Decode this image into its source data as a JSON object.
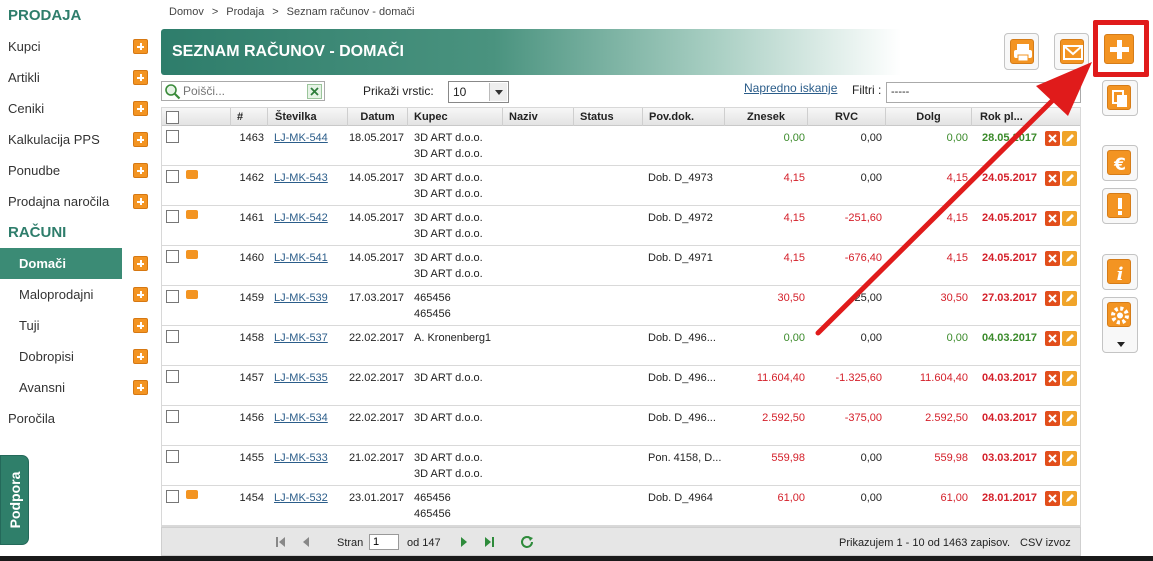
{
  "sidebar": {
    "section_prodaja": "PRODAJA",
    "items_prodaja": [
      "Kupci",
      "Artikli",
      "Ceniki",
      "Kalkulacija PPS",
      "Ponudbe",
      "Prodajna naročila"
    ],
    "section_racuni": "RAČUNI",
    "items_racuni": [
      "Domači",
      "Maloprodajni",
      "Tuji",
      "Dobropisi",
      "Avansni"
    ],
    "porocila": "Poročila"
  },
  "support_tab": "Podpora",
  "breadcrumb": [
    "Domov",
    "Prodaja",
    "Seznam računov - domači"
  ],
  "breadcrumb_sep": ">",
  "page_title": "SEZNAM RAČUNOV - DOMAČI",
  "toolbar": {
    "search_placeholder": "Poišči...",
    "rows_label": "Prikaži vrstic:",
    "rows_value": "10",
    "advanced_search": "Napredno iskanje",
    "filters_label": "Filtri :",
    "filters_value": "-----"
  },
  "table": {
    "headers": [
      "#",
      "Številka",
      "Datum",
      "Kupec",
      "Naziv",
      "Status",
      "Pov.dok.",
      "Znesek",
      "RVC",
      "Dolg",
      "Rok pl..."
    ],
    "rows": [
      {
        "id": "1463",
        "num": "LJ-MK-544",
        "date": "18.05.2017",
        "kupec": [
          "3D ART d.o.o.",
          "3D ART d.o.o."
        ],
        "pov": "",
        "znesek": "0,00",
        "rvc": "0,00",
        "dolg": "0,00",
        "rok": "28.05.2017",
        "printer": false,
        "kind": "pos"
      },
      {
        "id": "1462",
        "num": "LJ-MK-543",
        "date": "14.05.2017",
        "kupec": [
          "3D ART d.o.o.",
          "3D ART d.o.o."
        ],
        "pov": "Dob. D_4973",
        "znesek": "4,15",
        "rvc": "0,00",
        "dolg": "4,15",
        "rok": "24.05.2017",
        "printer": true,
        "kind": "neg"
      },
      {
        "id": "1461",
        "num": "LJ-MK-542",
        "date": "14.05.2017",
        "kupec": [
          "3D ART d.o.o.",
          "3D ART d.o.o."
        ],
        "pov": "Dob. D_4972",
        "znesek": "4,15",
        "rvc": "-251,60",
        "dolg": "4,15",
        "rok": "24.05.2017",
        "printer": true,
        "kind": "neg"
      },
      {
        "id": "1460",
        "num": "LJ-MK-541",
        "date": "14.05.2017",
        "kupec": [
          "3D ART d.o.o.",
          "3D ART d.o.o."
        ],
        "pov": "Dob. D_4971",
        "znesek": "4,15",
        "rvc": "-676,40",
        "dolg": "4,15",
        "rok": "24.05.2017",
        "printer": true,
        "kind": "neg"
      },
      {
        "id": "1459",
        "num": "LJ-MK-539",
        "date": "17.03.2017",
        "kupec": [
          "465456",
          "465456"
        ],
        "pov": "",
        "znesek": "30,50",
        "rvc": "25,00",
        "dolg": "30,50",
        "rok": "27.03.2017",
        "printer": true,
        "kind": "neg"
      },
      {
        "id": "1458",
        "num": "LJ-MK-537",
        "date": "22.02.2017",
        "kupec": [
          "A. Kronenberg1",
          ""
        ],
        "pov": "Dob. D_496...",
        "znesek": "0,00",
        "rvc": "0,00",
        "dolg": "0,00",
        "rok": "04.03.2017",
        "printer": false,
        "kind": "pos"
      },
      {
        "id": "1457",
        "num": "LJ-MK-535",
        "date": "22.02.2017",
        "kupec": [
          "3D ART d.o.o.",
          ""
        ],
        "pov": "Dob. D_496...",
        "znesek": "11.604,40",
        "rvc": "-1.325,60",
        "dolg": "11.604,40",
        "rok": "04.03.2017",
        "printer": false,
        "kind": "neg"
      },
      {
        "id": "1456",
        "num": "LJ-MK-534",
        "date": "22.02.2017",
        "kupec": [
          "3D ART d.o.o.",
          ""
        ],
        "pov": "Dob. D_496...",
        "znesek": "2.592,50",
        "rvc": "-375,00",
        "dolg": "2.592,50",
        "rok": "04.03.2017",
        "printer": false,
        "kind": "neg"
      },
      {
        "id": "1455",
        "num": "LJ-MK-533",
        "date": "21.02.2017",
        "kupec": [
          "3D ART d.o.o.",
          "3D ART d.o.o."
        ],
        "pov": "Pon. 4158, D...",
        "znesek": "559,98",
        "rvc": "0,00",
        "dolg": "559,98",
        "rok": "03.03.2017",
        "printer": false,
        "kind": "neg"
      },
      {
        "id": "1454",
        "num": "LJ-MK-532",
        "date": "23.01.2017",
        "kupec": [
          "465456",
          "465456"
        ],
        "pov": "Dob. D_4964",
        "znesek": "61,00",
        "rvc": "0,00",
        "dolg": "61,00",
        "rok": "28.01.2017",
        "printer": true,
        "kind": "neg"
      }
    ]
  },
  "pager": {
    "page_label": "Stran",
    "page_value": "1",
    "of_label": "od 147",
    "summary": "Prikazujem 1 - 10 od 1463 zapisov.",
    "csv": "CSV izvoz"
  },
  "icons": {
    "print": "printer-icon",
    "mail": "envelope-icon",
    "add": "plus-icon",
    "copy": "copy-icon",
    "euro": "euro-icon",
    "warn": "exclamation-icon",
    "info": "info-icon",
    "settings": "gear-icon"
  },
  "colors": {
    "brand": "#2e7d6b",
    "accent": "#f39422",
    "negative": "#d4202a",
    "positive": "#3a8a2a",
    "annotation": "#e01b1b"
  }
}
